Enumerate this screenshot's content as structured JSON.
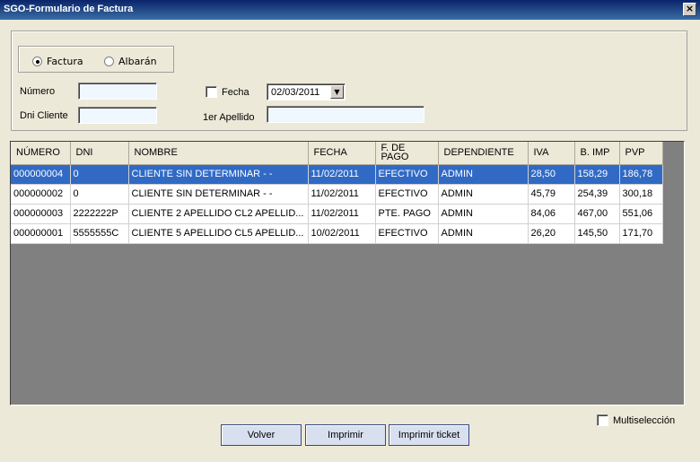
{
  "window": {
    "title": "SGO-Formulario de Factura",
    "close_glyph": "×"
  },
  "filters": {
    "radio_factura": "Factura",
    "radio_albaran": "Albarán",
    "numero_label": "Número",
    "dni_label": "Dni Cliente",
    "fecha_label": "Fecha",
    "fecha_value": "02/03/2011",
    "apellido_label": "1er Apellido",
    "numero_value": "",
    "dni_value": "",
    "apellido_value": ""
  },
  "grid": {
    "columns": [
      "NÚMERO",
      "DNI",
      "NOMBRE",
      "FECHA",
      "F. DE PAGO",
      "DEPENDIENTE",
      "IVA",
      "B. IMP",
      "PVP"
    ],
    "rows": [
      [
        "000000004",
        "0",
        "CLIENTE SIN DETERMINAR - -",
        "11/02/2011",
        "EFECTIVO",
        "ADMIN",
        "28,50",
        "158,29",
        "186,78"
      ],
      [
        "000000002",
        "0",
        "CLIENTE SIN DETERMINAR - -",
        "11/02/2011",
        "EFECTIVO",
        "ADMIN",
        "45,79",
        "254,39",
        "300,18"
      ],
      [
        "000000003",
        "2222222P",
        "CLIENTE 2 APELLIDO CL2 APELLID...",
        "11/02/2011",
        "PTE. PAGO",
        "ADMIN",
        "84,06",
        "467,00",
        "551,06"
      ],
      [
        "000000001",
        "5555555C",
        "CLIENTE 5 APELLIDO CL5 APELLID...",
        "10/02/2011",
        "EFECTIVO",
        "ADMIN",
        "26,20",
        "145,50",
        "171,70"
      ]
    ],
    "selected_row": 0
  },
  "footer": {
    "multiseleccion_label": "Multiselección",
    "volver": "Volver",
    "imprimir": "Imprimir",
    "imprimir_ticket": "Imprimir ticket"
  }
}
